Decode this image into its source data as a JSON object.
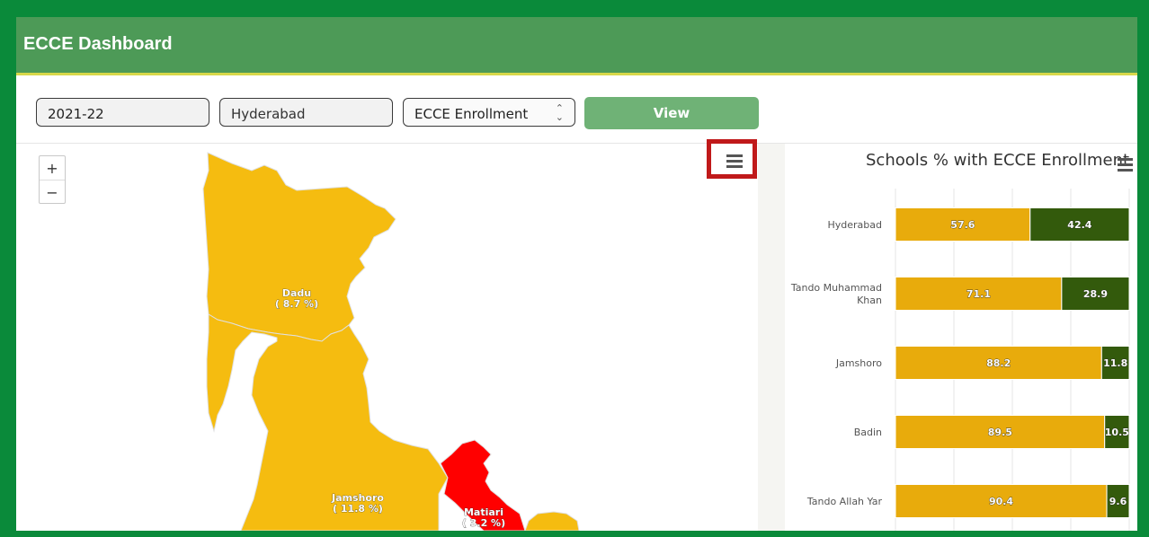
{
  "header": {
    "title": "ECCE Dashboard"
  },
  "filters": {
    "year": "2021-22",
    "district": "Hyderabad",
    "indicator": "ECCE Enrollment",
    "view_label": "View"
  },
  "map": {
    "zoom_in": "+",
    "zoom_out": "−",
    "regions": [
      {
        "name": "Dadu",
        "value": "( 8.7 %)",
        "color": "#f5bc10"
      },
      {
        "name": "Jamshoro",
        "value": "( 11.8 %)",
        "color": "#f5bc10"
      },
      {
        "name": "Matiari",
        "value": "( 3.2 %)",
        "color": "#ff0000"
      }
    ]
  },
  "chart_data": {
    "type": "bar",
    "stacked": true,
    "orientation": "horizontal",
    "title": "Schools % with ECCE Enrollment",
    "categories": [
      "Hyderabad",
      "Tando Muhammad Khan",
      "Jamshoro",
      "Badin",
      "Tando Allah Yar"
    ],
    "series": [
      {
        "values": [
          57.6,
          71.1,
          88.2,
          89.5,
          90.4
        ],
        "color": "#e8ab0c"
      },
      {
        "values": [
          42.4,
          28.9,
          11.8,
          10.5,
          9.6
        ],
        "color": "#335a0c"
      }
    ],
    "xlim": [
      0,
      100
    ],
    "grid": true
  }
}
